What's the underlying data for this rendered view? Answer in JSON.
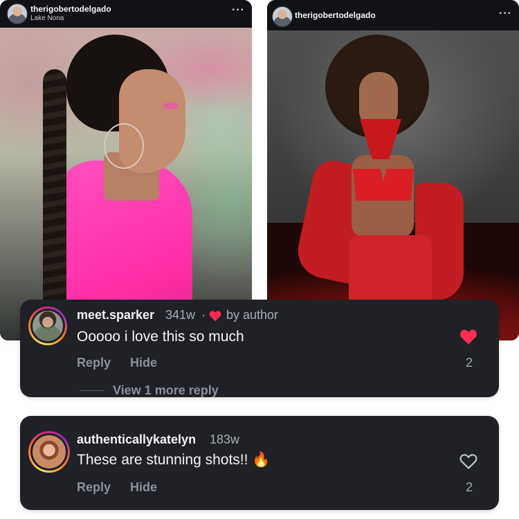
{
  "posts": [
    {
      "username": "therigobertodelgado",
      "location": "Lake Nona",
      "more_icon": "···",
      "photo_description_icon": "photo"
    },
    {
      "username": "therigobertodelgado",
      "location": "",
      "more_icon": "···",
      "photo_description_icon": "photo"
    }
  ],
  "comments": [
    {
      "username": "meet.sparker",
      "time": "341w",
      "separator": "·",
      "liked_by_author": "by author",
      "text": "Ooooo i love this so much",
      "reply_label": "Reply",
      "hide_label": "Hide",
      "like_count": "2",
      "liked": true,
      "view_more": "View 1 more reply"
    },
    {
      "username": "authenticallykatelyn",
      "time": "183w",
      "text": "These are stunning shots!! 🔥",
      "reply_label": "Reply",
      "hide_label": "Hide",
      "like_count": "2",
      "liked": false
    }
  ],
  "colors": {
    "card_bg": "#1f2126",
    "heart_red": "#fe2c55",
    "muted_text": "#a8abb2",
    "action_text": "#8d9098"
  }
}
